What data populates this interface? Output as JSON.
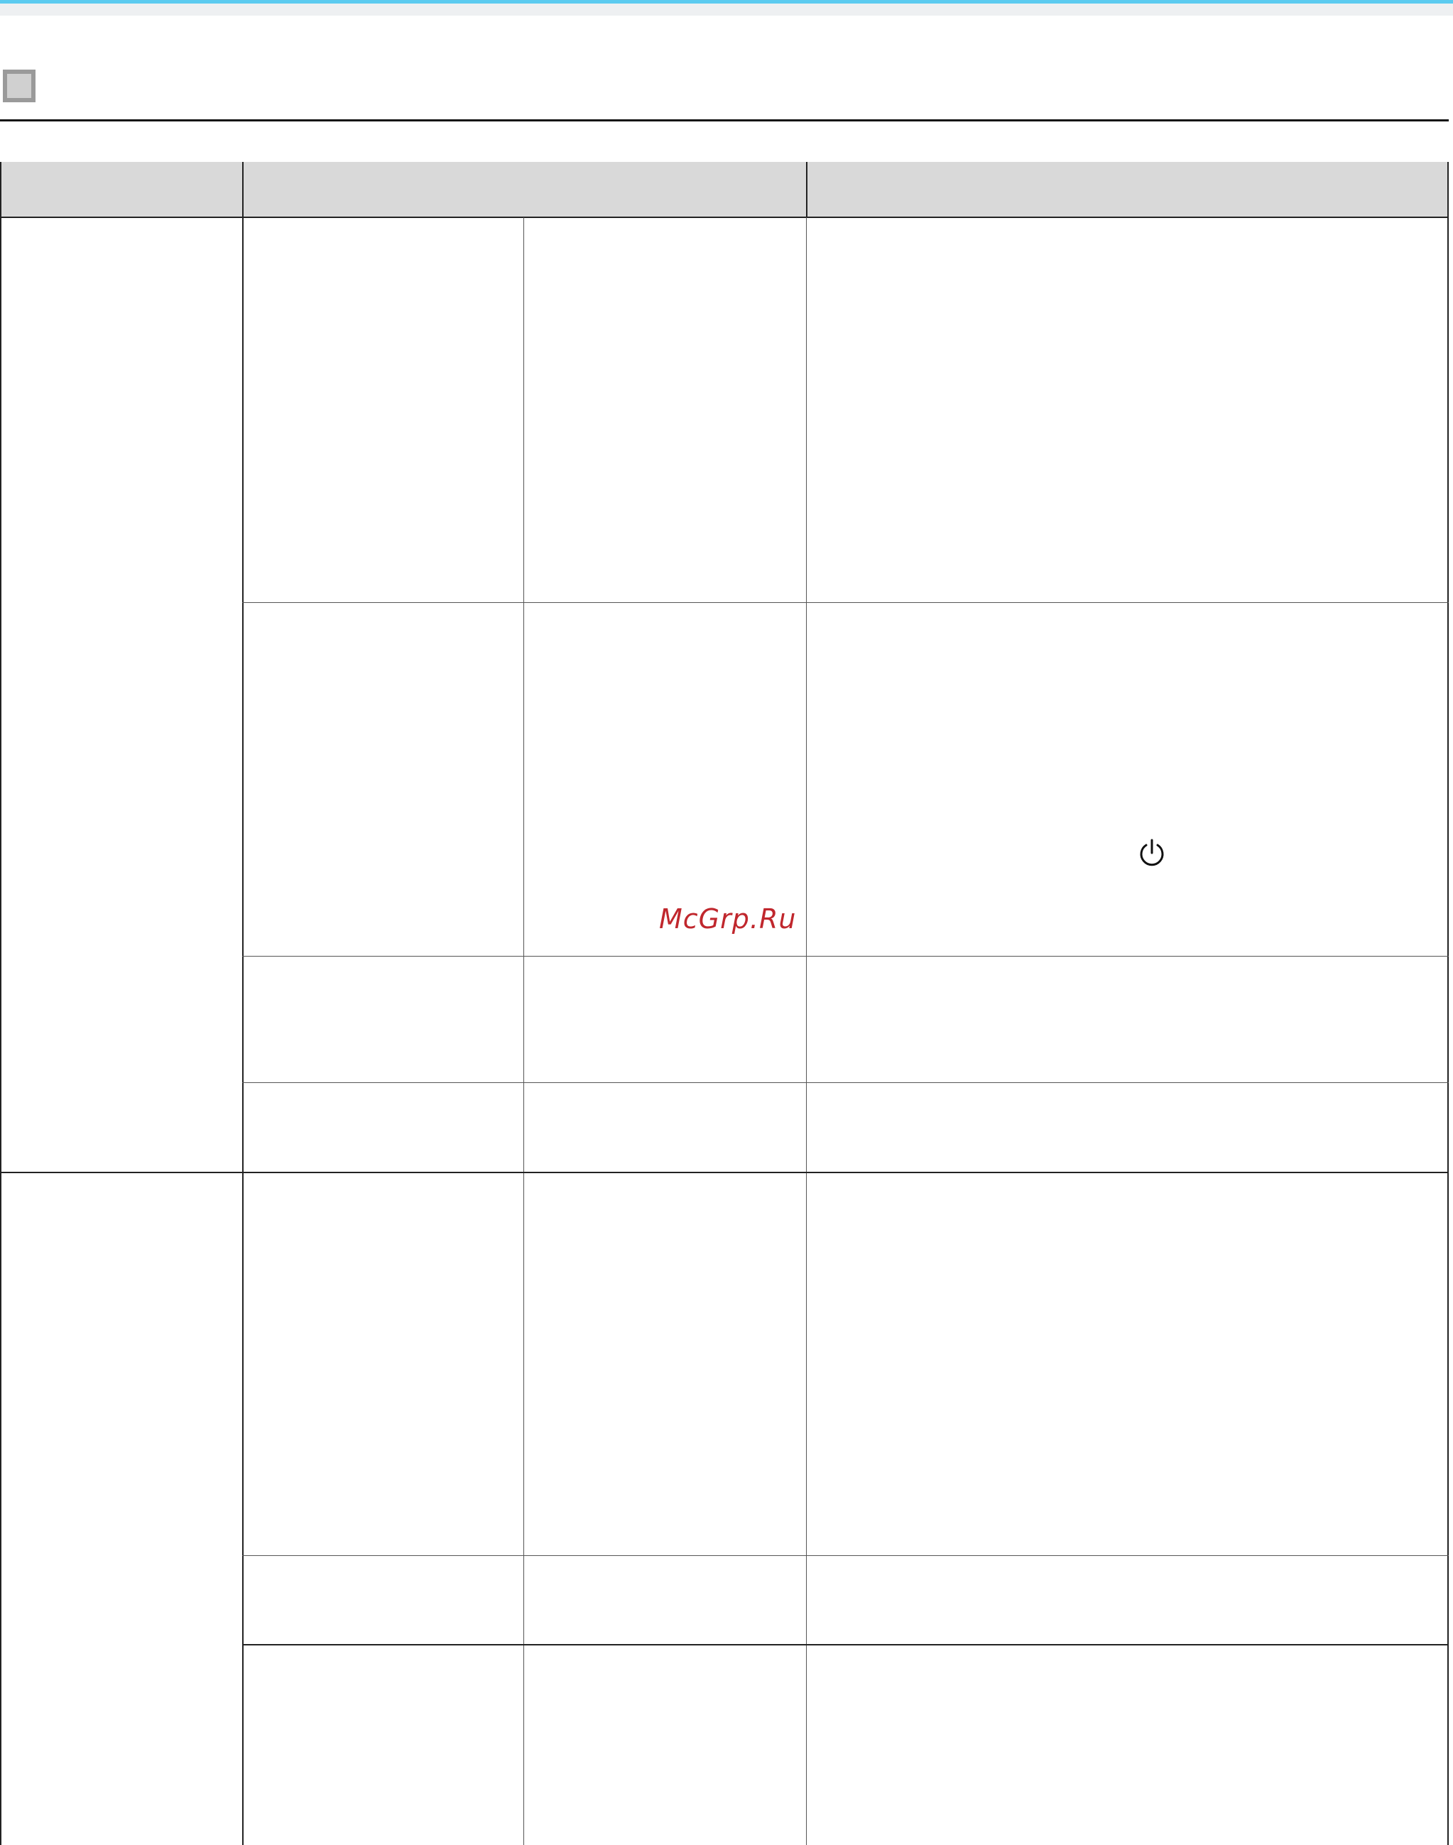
{
  "page": {
    "colors": {
      "top_stripe": "#5ccbf0",
      "header_fill": "#d9d9d9",
      "rule": "#222222",
      "watermark": "#c0272d"
    }
  },
  "section": {
    "icon": "gray-square-icon"
  },
  "table": {
    "header": [
      "",
      "",
      ""
    ],
    "groups": [
      {
        "label": "",
        "rows": [
          {
            "col_a": "",
            "col_b": "",
            "col_c": ""
          },
          {
            "col_a": "",
            "col_b": "",
            "col_c": "",
            "icon": "power-icon"
          },
          {
            "col_a": "",
            "col_b": "",
            "col_c": ""
          },
          {
            "col_a": "",
            "col_b": "",
            "col_c": ""
          }
        ]
      },
      {
        "label": "",
        "rows": [
          {
            "col_a": "",
            "col_b": "",
            "col_c": ""
          },
          {
            "col_a": "",
            "col_b": "",
            "col_c": ""
          },
          {
            "col_a": "",
            "col_b": "",
            "col_c": ""
          }
        ]
      }
    ]
  },
  "watermark": {
    "text": "McGrp.Ru"
  }
}
